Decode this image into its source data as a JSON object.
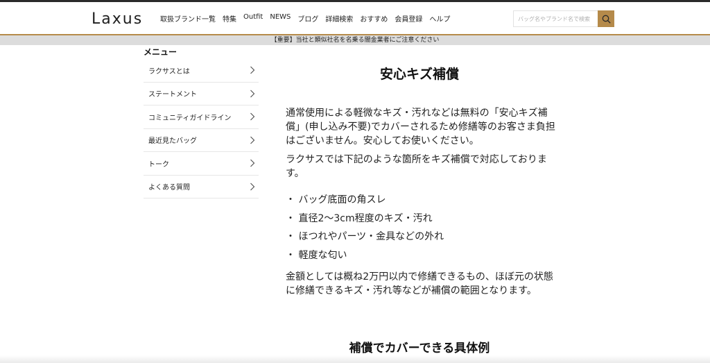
{
  "header": {
    "logo": "Laxus",
    "nav": [
      "取扱ブランド一覧",
      "特集",
      "Outfit",
      "NEWS",
      "ブログ",
      "詳細検索",
      "おすすめ",
      "会員登録",
      "ヘルプ"
    ],
    "search_placeholder": "バッグ名やブランド名で検索",
    "accent_color": "#b58a4a"
  },
  "notice": "【重要】当社と類似社名を名乗る闇金業者にご注意ください",
  "sidebar": {
    "heading": "メニュー",
    "items": [
      {
        "label": "ラクサスとは"
      },
      {
        "label": "ステートメント"
      },
      {
        "label": "コミュニティガイドライン"
      },
      {
        "label": "最近見たバッグ"
      },
      {
        "label": "トーク"
      },
      {
        "label": "よくある質問"
      }
    ]
  },
  "main": {
    "title": "安心キズ補償",
    "paragraph1": "通常使用による軽微なキズ・汚れなどは無料の「安心キズ補償」(申し込み不要)でカバーされるため修繕等のお客さま負担はございません。安心してお使いください。",
    "paragraph2": "ラクサスでは下記のような箇所をキズ補償で対応しております。",
    "bullets": [
      "・ バッグ底面の角スレ",
      "・ 直径2〜3cm程度のキズ・汚れ",
      "・ ほつれやパーツ・金具などの外れ",
      "・ 軽度な匂い"
    ],
    "paragraph3": "金額としては概ね2万円以内で修繕できるもの、ほぼ元の状態に修繕できるキズ・汚れ等などが補償の範囲となります。",
    "subtitle": "補償でカバーできる具体例"
  }
}
